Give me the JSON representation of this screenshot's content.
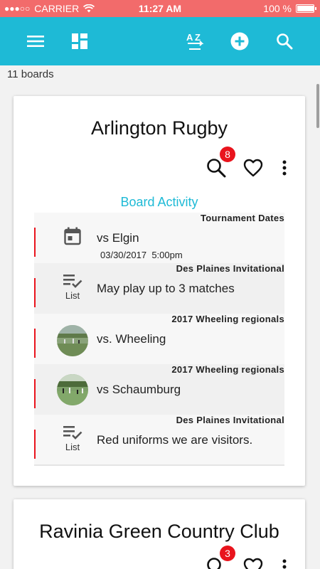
{
  "status": {
    "carrier": "CARRIER",
    "time": "11:27 AM",
    "battery": "100 %",
    "battery_level": 1.0
  },
  "toolbar": {
    "menu_icon": "menu-icon",
    "dashboard_icon": "dashboard-icon",
    "sort_icon": "sort-az-icon",
    "add_icon": "add-circle-icon",
    "search_icon": "search-icon"
  },
  "board_count": "11 boards",
  "colors": {
    "status_bar": "#f26b6b",
    "app_bar": "#1ebad6",
    "accent": "#1ebad6",
    "badge": "#e9141d",
    "activity_marker": "#e9141d"
  },
  "boards": [
    {
      "title": "Arlington Rugby",
      "badge": "8",
      "section_title": "Board Activity",
      "activity": [
        {
          "group": "Tournament Dates",
          "text": "vs Elgin",
          "date": "03/30/2017",
          "time": "5:00pm",
          "icon": "calendar-icon"
        },
        {
          "group": "Des Plaines Invitational",
          "text": "May play up to 3 matches",
          "icon": "list-check-icon",
          "icon_label": "List"
        },
        {
          "group": "2017 Wheeling regionals",
          "text": "vs. Wheeling",
          "icon": "photo-thumbnail"
        },
        {
          "group": "2017 Wheeling regionals",
          "text": "vs Schaumburg",
          "icon": "photo-thumbnail"
        },
        {
          "group": "Des Plaines Invitational",
          "text": "Red uniforms we are visitors.",
          "icon": "list-check-icon",
          "icon_label": "List"
        }
      ]
    },
    {
      "title": "Ravinia Green Country Club",
      "badge": "3"
    }
  ]
}
